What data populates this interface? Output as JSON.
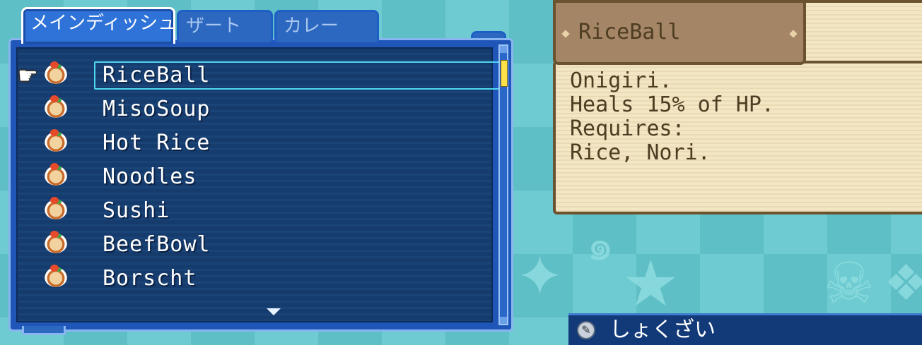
{
  "tabs": [
    {
      "label": "メインディッシュ",
      "active": true
    },
    {
      "label": "ザート",
      "active": false
    },
    {
      "label": "カレー",
      "active": false
    }
  ],
  "items": [
    {
      "name": "RiceBall",
      "icon": "dish-icon",
      "selected": true
    },
    {
      "name": "MisoSoup",
      "icon": "dish-icon"
    },
    {
      "name": "Hot Rice",
      "icon": "dish-icon"
    },
    {
      "name": "Noodles",
      "icon": "dish-icon"
    },
    {
      "name": "Sushi",
      "icon": "dish-icon"
    },
    {
      "name": "BeefBowl",
      "icon": "dish-icon"
    },
    {
      "name": "Borscht",
      "icon": "dish-icon"
    }
  ],
  "detail": {
    "title": "RiceBall",
    "lines": [
      "Onigiri.",
      "Heals 15% of HP.",
      "Requires:",
      "Rice, Nori."
    ]
  },
  "hint": {
    "icon": "wrench-icon",
    "text": "しょくざい"
  },
  "colors": {
    "menu_bg": "#163c6e",
    "menu_border": "#1f56b8",
    "selection": "#4fd7f0",
    "panel_bg": "#f2e6c4",
    "title_bg": "#a48667",
    "text_dark": "#4e3d22"
  }
}
